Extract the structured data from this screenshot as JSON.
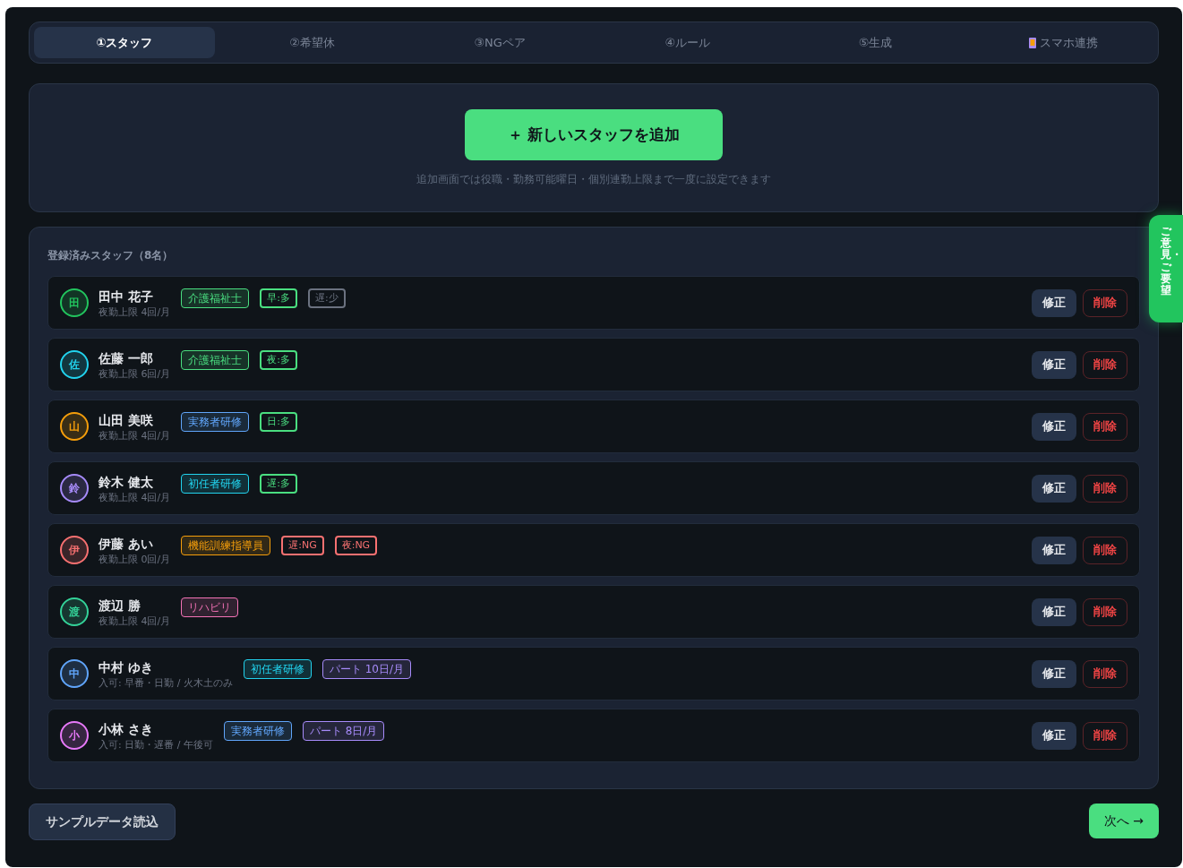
{
  "tabs": [
    {
      "label": "①スタッフ",
      "selected": true,
      "kind": "step"
    },
    {
      "label": "②希望休",
      "selected": false,
      "kind": "step"
    },
    {
      "label": "③NGペア",
      "selected": false,
      "kind": "step"
    },
    {
      "label": "④ルール",
      "selected": false,
      "kind": "step"
    },
    {
      "label": "⑤生成",
      "selected": false,
      "kind": "step"
    },
    {
      "label": "スマホ連携",
      "selected": false,
      "kind": "link"
    }
  ],
  "add_panel": {
    "button": "＋ 新しいスタッフを追加",
    "hint": "追加画面では役職・勤務可能曜日・個別連勤上限まで一度に設定できます"
  },
  "staff_list": {
    "title": "登録済みスタッフ（8名）",
    "rows": [
      {
        "initial": "田",
        "color": "#22c55e",
        "name": "田中 花子",
        "detail": "夜勤上限 4回/月",
        "tags": [
          {
            "kind": "qualification",
            "text": "介護福祉士",
            "color": "#4ade80"
          },
          {
            "kind": "preference",
            "text": "早:多",
            "color": "#4ade80"
          },
          {
            "kind": "preference",
            "text": "遅:少",
            "color": "#6b7280"
          }
        ],
        "edit": "修正",
        "delete": "削除"
      },
      {
        "initial": "佐",
        "color": "#22d3ee",
        "name": "佐藤 一郎",
        "detail": "夜勤上限 6回/月",
        "tags": [
          {
            "kind": "qualification",
            "text": "介護福祉士",
            "color": "#4ade80"
          },
          {
            "kind": "preference",
            "text": "夜:多",
            "color": "#4ade80"
          }
        ],
        "edit": "修正",
        "delete": "削除"
      },
      {
        "initial": "山",
        "color": "#f59e0b",
        "name": "山田 美咲",
        "detail": "夜勤上限 4回/月",
        "tags": [
          {
            "kind": "qualification",
            "text": "実務者研修",
            "color": "#60a5fa"
          },
          {
            "kind": "preference",
            "text": "日:多",
            "color": "#4ade80"
          }
        ],
        "edit": "修正",
        "delete": "削除"
      },
      {
        "initial": "鈴",
        "color": "#a78bfa",
        "name": "鈴木 健太",
        "detail": "夜勤上限 4回/月",
        "tags": [
          {
            "kind": "qualification",
            "text": "初任者研修",
            "color": "#22d3ee"
          },
          {
            "kind": "preference",
            "text": "遅:多",
            "color": "#4ade80"
          }
        ],
        "edit": "修正",
        "delete": "削除"
      },
      {
        "initial": "伊",
        "color": "#f87171",
        "name": "伊藤 あい",
        "detail": "夜勤上限 0回/月",
        "tags": [
          {
            "kind": "qualification",
            "text": "機能訓練指導員",
            "color": "#f59e0b"
          },
          {
            "kind": "preference",
            "text": "遅:NG",
            "color": "#f87171"
          },
          {
            "kind": "preference",
            "text": "夜:NG",
            "color": "#f87171"
          }
        ],
        "edit": "修正",
        "delete": "削除"
      },
      {
        "initial": "渡",
        "color": "#34d399",
        "name": "渡辺 勝",
        "detail": "夜勤上限 4回/月",
        "tags": [
          {
            "kind": "qualification",
            "text": "リハビリ",
            "color": "#f472b6"
          }
        ],
        "edit": "修正",
        "delete": "削除"
      },
      {
        "initial": "中",
        "color": "#60a5fa",
        "name": "中村 ゆき",
        "detail": "入可: 早番・日勤 / 火木土のみ",
        "tags": [
          {
            "kind": "qualification",
            "text": "初任者研修",
            "color": "#22d3ee"
          },
          {
            "kind": "qualification",
            "text": "パート 10日/月",
            "color": "#a78bfa"
          }
        ],
        "edit": "修正",
        "delete": "削除"
      },
      {
        "initial": "小",
        "color": "#e879f9",
        "name": "小林 さき",
        "detail": "入可: 日勤・遅番 / 午後可",
        "tags": [
          {
            "kind": "qualification",
            "text": "実務者研修",
            "color": "#60a5fa"
          },
          {
            "kind": "qualification",
            "text": "パート 8日/月",
            "color": "#a78bfa"
          }
        ],
        "edit": "修正",
        "delete": "削除"
      }
    ]
  },
  "footer": {
    "sample_button": "サンプルデータ読込",
    "next_button": "次へ →"
  },
  "feedback_tab": "ご意見・ご要望"
}
